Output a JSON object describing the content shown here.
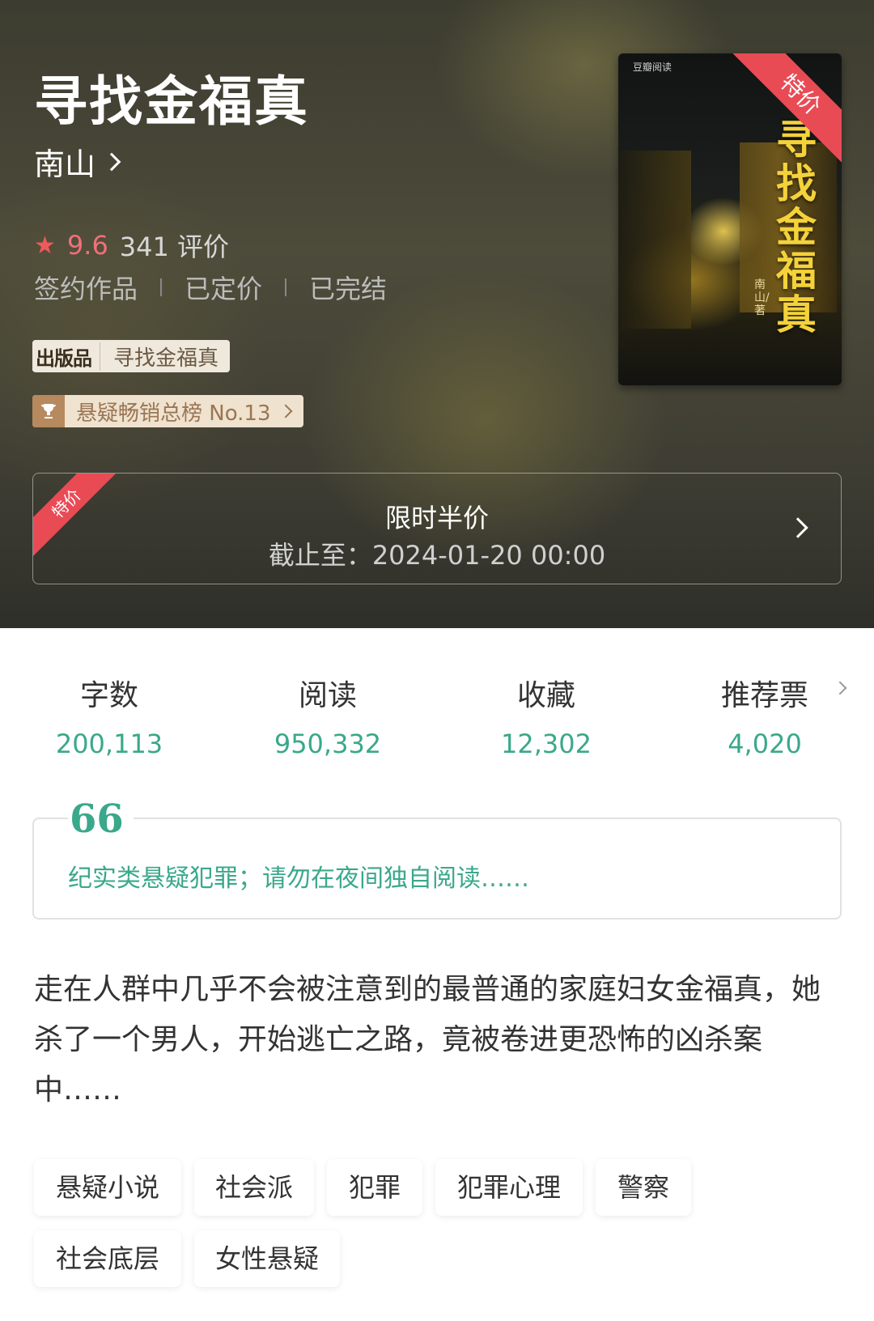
{
  "book": {
    "title": "寻找金福真",
    "author": "南山",
    "rating": {
      "star_icon": "star-icon",
      "score": "9.6",
      "reviews": "341 评价"
    },
    "meta": [
      "签约作品",
      "已定价",
      "已完结"
    ],
    "publisher_tag": {
      "logo": "出版品",
      "text": "寻找金福真"
    },
    "rank_tag": {
      "icon": "trophy-icon",
      "text": "悬疑畅销总榜 No.13"
    },
    "cover": {
      "logo": "豆瓣阅读",
      "title": "寻找金福真",
      "author": "南山/著",
      "ribbon": "特价"
    }
  },
  "promo": {
    "ribbon": "特价",
    "title": "限时半价",
    "deadline": "截止至：2024-01-20 00:00"
  },
  "stats": [
    {
      "label": "字数",
      "value": "200,113"
    },
    {
      "label": "阅读",
      "value": "950,332"
    },
    {
      "label": "收藏",
      "value": "12,302"
    },
    {
      "label": "推荐票",
      "value": "4,020"
    }
  ],
  "quote": {
    "mark": "66",
    "text": "纪实类悬疑犯罪；请勿在夜间独自阅读……"
  },
  "description": "走在人群中几乎不会被注意到的最普通的家庭妇女金福真，她杀了一个男人，开始逃亡之路，竟被卷进更恐怖的凶杀案中……",
  "tags": [
    "悬疑小说",
    "社会派",
    "犯罪",
    "犯罪心理",
    "警察",
    "社会底层",
    "女性悬疑"
  ],
  "colors": {
    "accent_green": "#3aa88b",
    "ribbon_red": "#e94b55",
    "score_red": "#f0707a"
  }
}
